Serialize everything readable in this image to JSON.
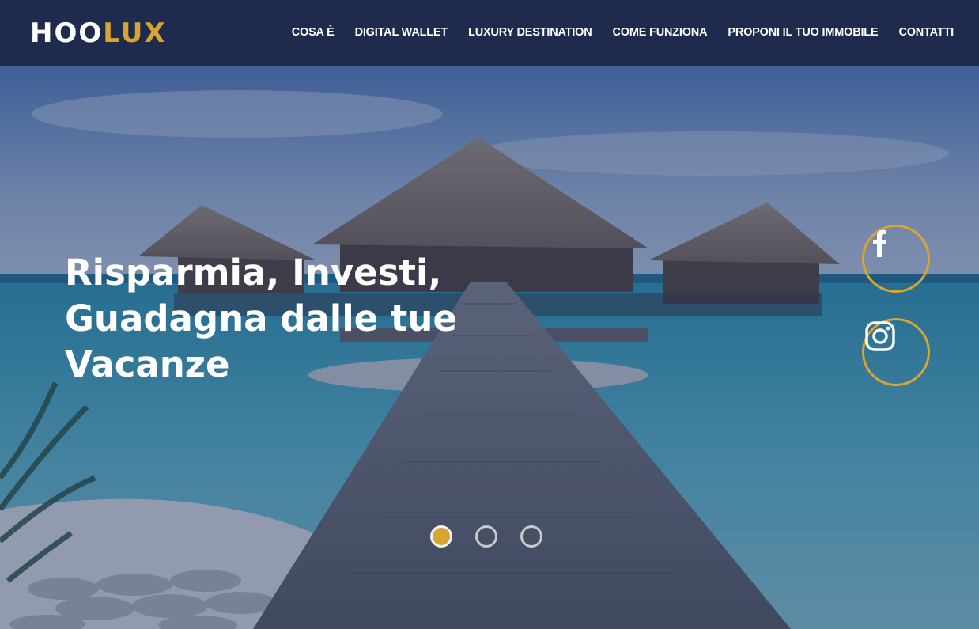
{
  "header": {
    "logo_part1": "HOO",
    "logo_part2": "LUX",
    "nav": [
      {
        "label": "COSA È"
      },
      {
        "label": "DIGITAL WALLET"
      },
      {
        "label": "LUXURY DESTINATION"
      },
      {
        "label": "COME FUNZIONA"
      },
      {
        "label": "PROPONI IL TUO IMMOBILE"
      },
      {
        "label": "CONTATTI"
      }
    ]
  },
  "hero": {
    "headline_lines": [
      "Risparmia, Investi,",
      "Guadagna dalle tue",
      "Vacanze"
    ],
    "social": [
      {
        "icon": "facebook-icon"
      },
      {
        "icon": "instagram-icon"
      }
    ],
    "slider": {
      "slides": 3,
      "active_slide": 1
    }
  },
  "colors": {
    "header_bg": "#1f2b4c",
    "accent": "#d9a531",
    "overlay": "#1a285c"
  }
}
